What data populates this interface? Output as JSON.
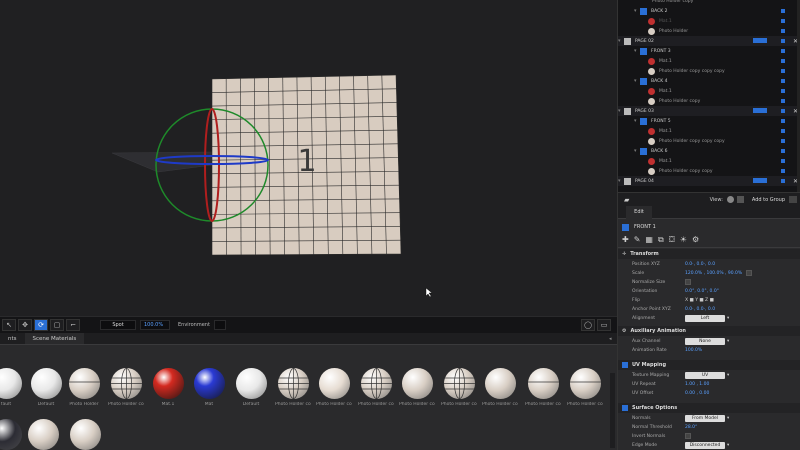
{
  "viewport": {
    "face_number": "1",
    "zoom": "100.0%",
    "light_label": "Spot",
    "environment_label": "Environment"
  },
  "materials_panel": {
    "tabs": [
      "nts",
      "Scene Materials"
    ],
    "items": [
      {
        "label": "fault",
        "color": "#e8e8e8",
        "style": "plain"
      },
      {
        "label": "Default",
        "color": "#e8e8e8",
        "style": "plain"
      },
      {
        "label": "Photo Holder",
        "color": "#d8cec4",
        "style": "line"
      },
      {
        "label": "Photo Holder copy",
        "color": "#d8cec4",
        "style": "grid"
      },
      {
        "label": "Mat.1",
        "color": "#d42a20",
        "style": "shiny"
      },
      {
        "label": "Mat",
        "color": "#2a3ad4",
        "style": "shiny"
      },
      {
        "label": "Default",
        "color": "#e8e8e8",
        "style": "plain"
      },
      {
        "label": "Photo Holder copy",
        "color": "#d8cec4",
        "style": "grid"
      },
      {
        "label": "Photo Holder copy",
        "color": "#e6dcd2",
        "style": "plain"
      },
      {
        "label": "Photo Holder copy",
        "color": "#d8cec4",
        "style": "grid"
      },
      {
        "label": "Photo Holder copy",
        "color": "#d8cec4",
        "style": "plain"
      },
      {
        "label": "Photo Holder copy",
        "color": "#d8cec4",
        "style": "grid"
      },
      {
        "label": "Photo Holder copy",
        "color": "#d8cec4",
        "style": "plain"
      },
      {
        "label": "Photo Holder copy",
        "color": "#d8cec4",
        "style": "line"
      },
      {
        "label": "Photo Holder copy",
        "color": "#d8cec4",
        "style": "line"
      },
      {
        "label": "Photo Holder copy",
        "color": "#2c2c34",
        "style": "plain"
      },
      {
        "label": "Photo Holder copy",
        "color": "#d8cec4",
        "style": "plain"
      },
      {
        "label": "Photo Holder copy",
        "color": "#d8cec4",
        "style": "plain"
      }
    ]
  },
  "layers": {
    "rows": [
      {
        "type": "sub",
        "label": "Photo Holder copy"
      },
      {
        "type": "face",
        "label": "BACK 2"
      },
      {
        "type": "mat",
        "label": "Mat.1",
        "color": "#c03030",
        "dim": true
      },
      {
        "type": "mat",
        "label": "Photo Holder",
        "color": "#d8cec4"
      },
      {
        "type": "page",
        "label": "PAGE 02"
      },
      {
        "type": "face",
        "label": "FRONT 3"
      },
      {
        "type": "mat",
        "label": "Mat.1",
        "color": "#c03030"
      },
      {
        "type": "mat",
        "label": "Photo Holder copy copy copy",
        "color": "#d8cec4"
      },
      {
        "type": "face",
        "label": "BACK 4"
      },
      {
        "type": "mat",
        "label": "Mat.1",
        "color": "#c03030"
      },
      {
        "type": "mat",
        "label": "Photo Holder copy",
        "color": "#d8cec4"
      },
      {
        "type": "page",
        "label": "PAGE 03"
      },
      {
        "type": "face",
        "label": "FRONT 5"
      },
      {
        "type": "mat",
        "label": "Mat.1",
        "color": "#c03030"
      },
      {
        "type": "mat",
        "label": "Photo Holder copy copy copy",
        "color": "#d8cec4"
      },
      {
        "type": "face",
        "label": "BACK 6"
      },
      {
        "type": "mat",
        "label": "Mat.1",
        "color": "#c03030"
      },
      {
        "type": "mat",
        "label": "Photo Holder copy copy",
        "color": "#d8cec4"
      },
      {
        "type": "page",
        "label": "PAGE 04"
      }
    ],
    "view_label": "View:",
    "add_group_label": "Add to Group"
  },
  "edit": {
    "tab_label": "Edit",
    "object_name": "FRONT 1",
    "transform": {
      "title": "Transform",
      "position_label": "Position XYZ",
      "position_value": "0.0·, 0.0·, 0.0",
      "scale_label": "Scale",
      "scale_value": "120.0% , 100.0% , 90.0%",
      "normalize_label": "Normalize Size",
      "orientation_label": "Orientation",
      "orientation_value": "0.0°, 0.0°, 0.0°",
      "flip_label": "Flip",
      "flip_value": "X ■ Y ■ Z ■",
      "anchor_label": "Anchor Point XYZ",
      "anchor_value": "0.0·, 0.0·, 0.0",
      "alignment_label": "Alignment",
      "alignment_value": "Left"
    },
    "aux": {
      "title": "Auxiliary Animation",
      "channel_label": "Aux Channel",
      "channel_value": "None",
      "rate_label": "Animation Rate",
      "rate_value": "100.0%"
    },
    "uv": {
      "title": "UV Mapping",
      "texture_label": "Texture Mapping",
      "texture_value": "UV",
      "repeat_label": "UV Repeat",
      "repeat_value": "1.00 , 1.00",
      "offset_label": "UV Offset",
      "offset_value": "0.00 , 0.00"
    },
    "surface": {
      "title": "Surface Options",
      "normals_label": "Normals",
      "normals_value": "From Model",
      "threshold_label": "Normal Threshold",
      "threshold_value": "28.0°",
      "invert_label": "Invert Normals",
      "edge_label": "Edge Mode",
      "edge_value": "Disconnected"
    }
  }
}
